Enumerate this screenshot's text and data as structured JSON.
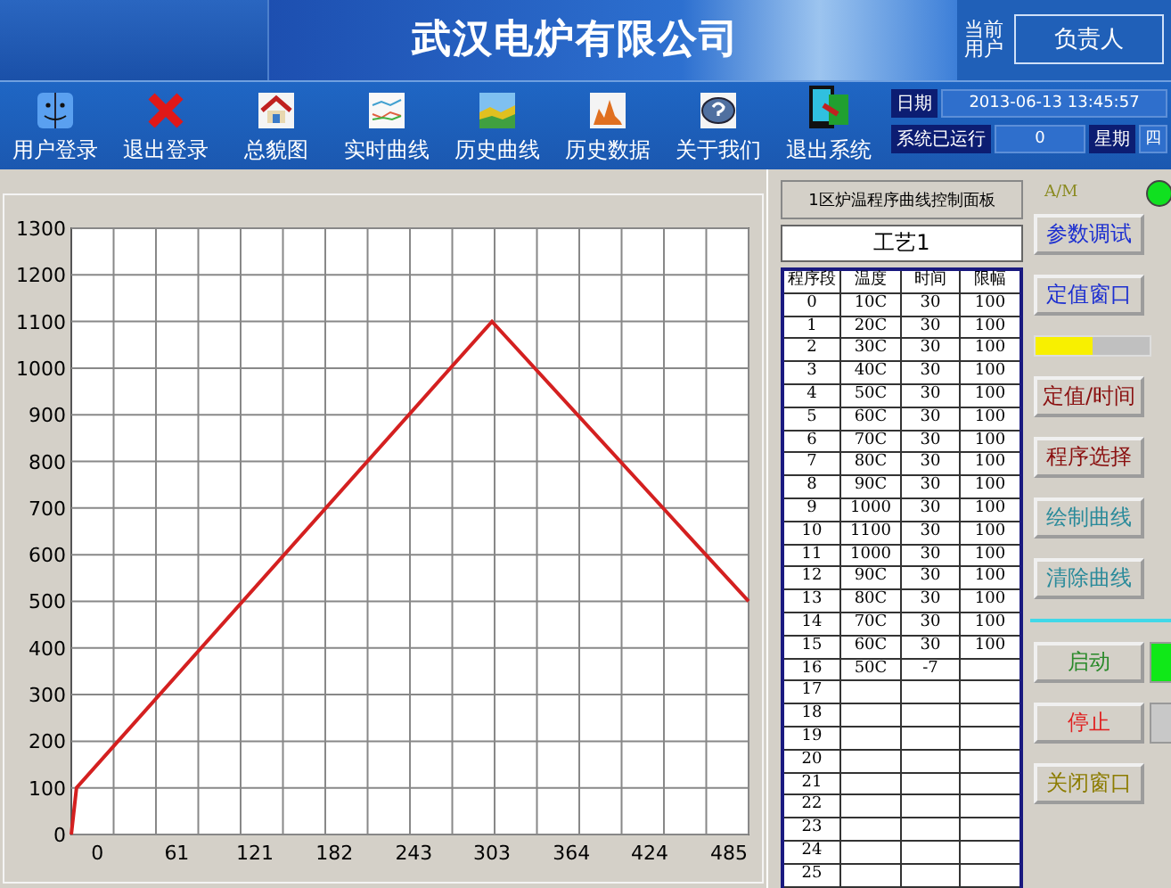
{
  "header": {
    "company": "武汉电炉有限公司",
    "user_label": "当前用户",
    "user": "负责人"
  },
  "toolbar": [
    {
      "label": "用户登录",
      "kind": "face"
    },
    {
      "label": "退出登录",
      "kind": "cross"
    },
    {
      "label": "总貌图",
      "kind": "house"
    },
    {
      "label": "实时曲线",
      "kind": "lines"
    },
    {
      "label": "历史曲线",
      "kind": "area"
    },
    {
      "label": "历史数据",
      "kind": "bars"
    },
    {
      "label": "关于我们",
      "kind": "help"
    },
    {
      "label": "退出系统",
      "kind": "exit"
    }
  ],
  "info": {
    "date_label": "日期",
    "date": "2013-06-13 13:45:57",
    "uptime_label": "系统已运行",
    "uptime": "0",
    "weekday_label": "星期",
    "weekday": "四"
  },
  "chart": {
    "chart_data": {
      "type": "line",
      "grid": true,
      "x": [
        -20,
        -16,
        303,
        500
      ],
      "series": [
        {
          "color": "#d42020",
          "values": [
            0,
            100,
            1100,
            500
          ]
        }
      ],
      "xlim": [
        -20,
        500
      ],
      "ylim": [
        0,
        1300
      ],
      "xticks": [
        0,
        61,
        121,
        182,
        243,
        303,
        364,
        424,
        485
      ],
      "yticks": [
        0,
        100,
        200,
        300,
        400,
        500,
        600,
        700,
        800,
        900,
        1000,
        1100,
        1200,
        1300
      ]
    }
  },
  "panel": {
    "title": "1区炉温程序曲线控制面板",
    "recipe": "工艺1",
    "mode_label": "A/M",
    "mode_on": true,
    "columns": [
      "程序段",
      "温度",
      "时间",
      "限幅"
    ],
    "rows": [
      {
        "seg": "0",
        "temp": "10C",
        "time": "30",
        "limit": "100"
      },
      {
        "seg": "1",
        "temp": "20C",
        "time": "30",
        "limit": "100"
      },
      {
        "seg": "2",
        "temp": "30C",
        "time": "30",
        "limit": "100"
      },
      {
        "seg": "3",
        "temp": "40C",
        "time": "30",
        "limit": "100"
      },
      {
        "seg": "4",
        "temp": "50C",
        "time": "30",
        "limit": "100"
      },
      {
        "seg": "5",
        "temp": "60C",
        "time": "30",
        "limit": "100"
      },
      {
        "seg": "6",
        "temp": "70C",
        "time": "30",
        "limit": "100"
      },
      {
        "seg": "7",
        "temp": "80C",
        "time": "30",
        "limit": "100"
      },
      {
        "seg": "8",
        "temp": "90C",
        "time": "30",
        "limit": "100"
      },
      {
        "seg": "9",
        "temp": "1000",
        "time": "30",
        "limit": "100"
      },
      {
        "seg": "10",
        "temp": "1100",
        "time": "30",
        "limit": "100"
      },
      {
        "seg": "11",
        "temp": "1000",
        "time": "30",
        "limit": "100"
      },
      {
        "seg": "12",
        "temp": "90C",
        "time": "30",
        "limit": "100"
      },
      {
        "seg": "13",
        "temp": "80C",
        "time": "30",
        "limit": "100"
      },
      {
        "seg": "14",
        "temp": "70C",
        "time": "30",
        "limit": "100"
      },
      {
        "seg": "15",
        "temp": "60C",
        "time": "30",
        "limit": "100"
      },
      {
        "seg": "16",
        "temp": "50C",
        "time": "-7"
      },
      {
        "seg": "17"
      },
      {
        "seg": "18"
      },
      {
        "seg": "19"
      },
      {
        "seg": "20"
      },
      {
        "seg": "21"
      },
      {
        "seg": "22"
      },
      {
        "seg": "23"
      },
      {
        "seg": "24"
      },
      {
        "seg": "25"
      }
    ],
    "controls": [
      {
        "kind": "button",
        "label": "参数调试",
        "color": "#1c2fd0"
      },
      {
        "kind": "button",
        "label": "定值窗口",
        "color": "#1c2fd0"
      },
      {
        "kind": "meter",
        "level": 0.5
      },
      {
        "kind": "button",
        "label": "定值/时间",
        "color": "#8a1010"
      },
      {
        "kind": "button",
        "label": "程序选择",
        "color": "#8a1010"
      },
      {
        "kind": "button",
        "label": "绘制曲线",
        "color": "#2a8a9a"
      },
      {
        "kind": "button",
        "label": "清除曲线",
        "color": "#2a8a9a"
      },
      {
        "kind": "rule"
      },
      {
        "kind": "button",
        "label": "启动",
        "color": "#2a8a2a",
        "indicator_on": true
      },
      {
        "kind": "button",
        "label": "停止",
        "color": "#e02020",
        "indicator_on": false
      },
      {
        "kind": "button",
        "label": "关闭窗口",
        "color": "#8c7c00"
      }
    ]
  }
}
